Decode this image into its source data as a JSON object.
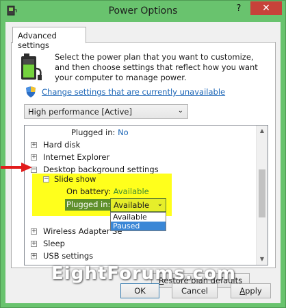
{
  "window": {
    "title": "Power Options",
    "help_label": "?",
    "close_label": "✕"
  },
  "tab": {
    "label": "Advanced settings"
  },
  "description": "Select the power plan that you want to customize, and then choose settings that reflect how you want your computer to manage power.",
  "change_link": "Change settings that are currently unavailable",
  "plan_select": {
    "value": "High performance [Active]"
  },
  "tree": {
    "plugged_in_top_label": "Plugged in:",
    "plugged_in_top_value": "No",
    "hard_disk": "Hard disk",
    "internet_explorer": "Internet Explorer",
    "desktop_background": "Desktop background settings",
    "slide_show": "Slide show",
    "on_battery_label": "On battery:",
    "on_battery_value": "Available",
    "plugged_in_label": "Plugged in:",
    "plugged_in_value": "Available",
    "wireless_adapter": "Wireless Adapter Se",
    "sleep": "Sleep",
    "usb_settings": "USB settings"
  },
  "dropdown": {
    "options": [
      "Available",
      "Paused"
    ],
    "selected_index": 1
  },
  "buttons": {
    "restore": "Restore plan defaults",
    "restore_underline": "R",
    "restore_rest": "estore plan defaults",
    "ok": "OK",
    "cancel": "Cancel",
    "apply": "Apply",
    "apply_underline": "A",
    "apply_rest": "pply"
  },
  "watermark": "EightForums.com",
  "colors": {
    "window_frame": "#69c36e",
    "highlight_yellow": "#ffff1c",
    "link_blue": "#1b65b6",
    "annotation_red": "#e11b1b",
    "close_red": "#c7423a",
    "selected_option": "#3a87d6"
  }
}
